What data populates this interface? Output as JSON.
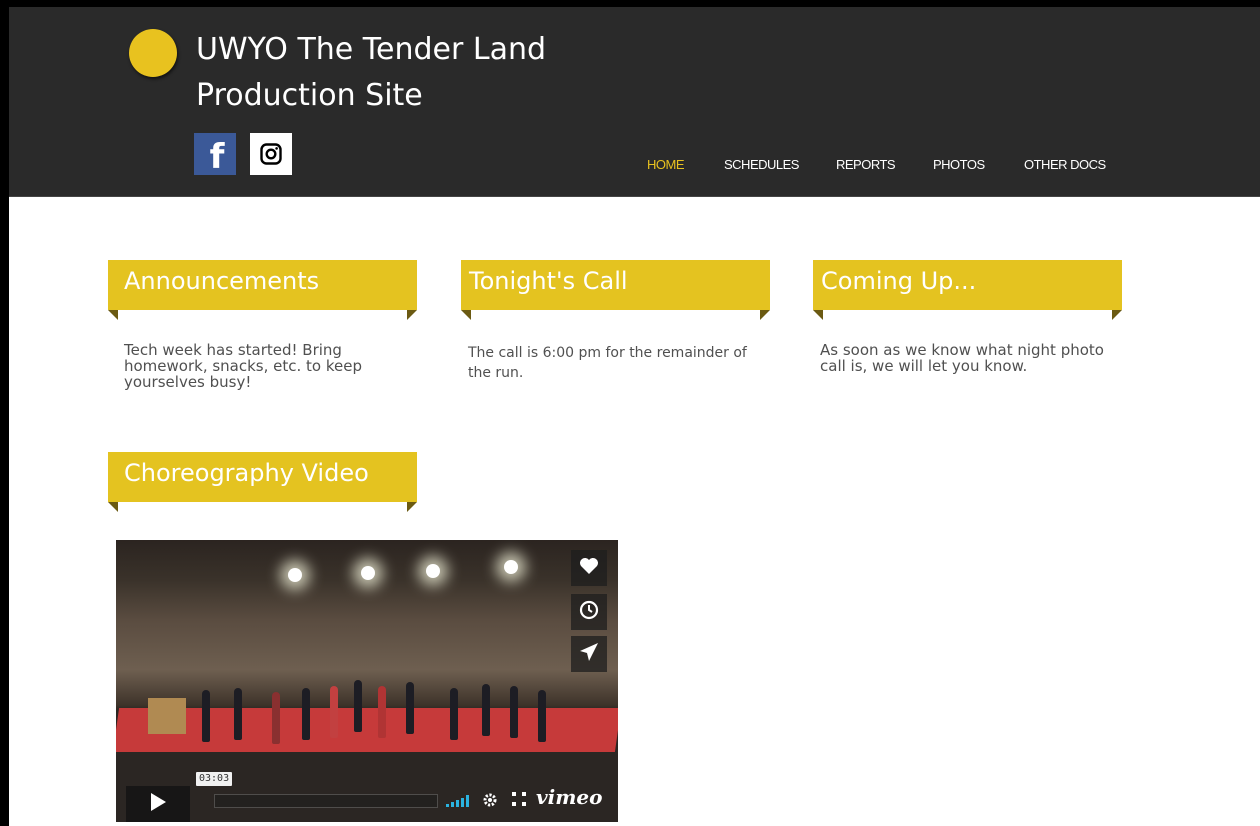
{
  "site": {
    "title": "UWYO The Tender Land Production Site",
    "brand_color": "#e8c21f",
    "social": [
      {
        "name": "facebook",
        "icon": "facebook-icon",
        "glyph": "f"
      },
      {
        "name": "instagram",
        "icon": "instagram-icon"
      }
    ]
  },
  "nav": {
    "active": "HOME",
    "items": [
      "HOME",
      "SCHEDULES",
      "REPORTS",
      "PHOTOS",
      "OTHER DOCS"
    ]
  },
  "sections": {
    "announcements": {
      "heading": "Announcements",
      "body": "Tech week has started! Bring homework, snacks, etc. to keep yourselves busy!"
    },
    "tonights_call": {
      "heading": "Tonight's Call",
      "body": "The call is 6:00 pm for the remainder of the run."
    },
    "coming_up": {
      "heading": "Coming Up...",
      "body": "As soon as we know what night photo call is, we will let you know."
    },
    "choreography": {
      "heading": "Choreography Video"
    }
  },
  "video": {
    "duration": "03:03",
    "player_brand": "vimeo",
    "side_icons": [
      "heart-icon",
      "clock-icon",
      "paper-plane-icon"
    ]
  }
}
